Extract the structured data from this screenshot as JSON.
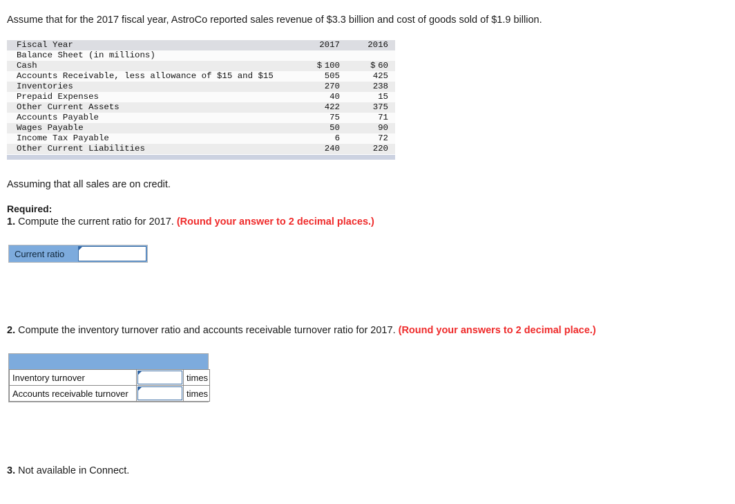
{
  "intro": "Assume that for the 2017 fiscal year, AstroCo reported sales revenue of $3.3 billion and cost of goods sold of $1.9 billion.",
  "balance_sheet": {
    "columns": [
      "Fiscal Year",
      "2017",
      "2016"
    ],
    "subtitle": "Balance Sheet (in millions)",
    "rows": [
      {
        "label": "Cash",
        "y2017": "100",
        "y2016": "60",
        "dollar": true
      },
      {
        "label": "Accounts Receivable, less allowance of $15 and $15",
        "y2017": "505",
        "y2016": "425",
        "dollar": false
      },
      {
        "label": "Inventories",
        "y2017": "270",
        "y2016": "238",
        "dollar": false
      },
      {
        "label": "Prepaid Expenses",
        "y2017": "40",
        "y2016": "15",
        "dollar": false
      },
      {
        "label": "Other Current Assets",
        "y2017": "422",
        "y2016": "375",
        "dollar": false
      },
      {
        "label": "Accounts Payable",
        "y2017": "75",
        "y2016": "71",
        "dollar": false
      },
      {
        "label": "Wages Payable",
        "y2017": "50",
        "y2016": "90",
        "dollar": false
      },
      {
        "label": "Income Tax Payable",
        "y2017": "6",
        "y2016": "72",
        "dollar": false
      },
      {
        "label": "Other Current Liabilities",
        "y2017": "240",
        "y2016": "220",
        "dollar": false
      }
    ],
    "currency_symbol": "$"
  },
  "assuming_note": "Assuming that all sales are on credit.",
  "required_label": "Required:",
  "questions": {
    "q1": {
      "number": "1.",
      "text": "Compute the current ratio for 2017.",
      "round_note": "(Round your answer to 2 decimal places.)"
    },
    "q2": {
      "number": "2.",
      "text": "Compute the inventory turnover ratio and accounts receivable turnover ratio for 2017.",
      "round_note": "(Round your answers to 2 decimal place.)"
    },
    "q3": {
      "number": "3.",
      "text": "Not available in Connect."
    }
  },
  "answer_widget_1": {
    "label": "Current ratio",
    "value": "",
    "placeholder": ""
  },
  "answer_widget_2": {
    "header": "",
    "rows": [
      {
        "label": "Inventory turnover",
        "value": "",
        "unit": "times"
      },
      {
        "label": "Accounts receivable turnover",
        "value": "",
        "unit": "times"
      }
    ]
  },
  "colors": {
    "accent_blue": "#7dabdd",
    "input_border_blue": "#3c6ea5",
    "round_note_red": "#ef2b2b",
    "table_header_gray": "#dcdde2",
    "table_stripe_gray": "#ececec",
    "footer_bar": "#ccd2e1"
  }
}
